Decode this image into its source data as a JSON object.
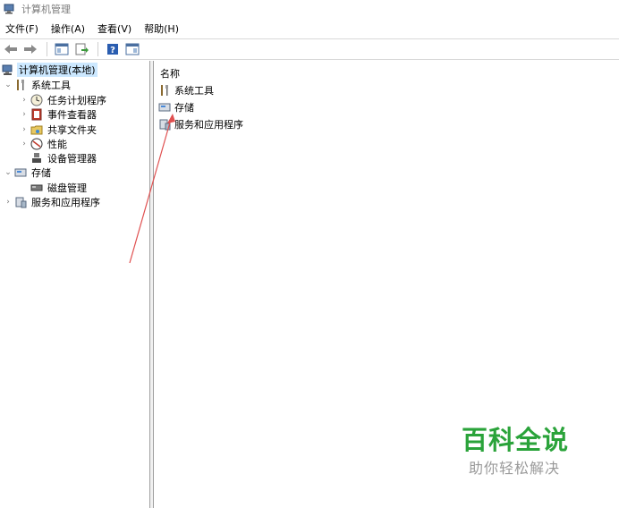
{
  "window": {
    "title": "计算机管理"
  },
  "menu": [
    {
      "label": "文件(F)"
    },
    {
      "label": "操作(A)"
    },
    {
      "label": "查看(V)"
    },
    {
      "label": "帮助(H)"
    }
  ],
  "toolbar": {
    "buttons": [
      "back-arrow-icon",
      "forward-arrow-icon",
      "show-hide-tree-icon",
      "export-list-icon",
      "help-icon",
      "properties-icon"
    ]
  },
  "tree": {
    "root": "计算机管理(本地)",
    "system_tools": "系统工具",
    "task_scheduler": "任务计划程序",
    "event_viewer": "事件查看器",
    "shared_folders": "共享文件夹",
    "performance": "性能",
    "device_manager": "设备管理器",
    "storage": "存储",
    "disk_management": "磁盘管理",
    "services_apps": "服务和应用程序"
  },
  "list": {
    "column_name": "名称",
    "items": [
      "系统工具",
      "存储",
      "服务和应用程序"
    ]
  },
  "watermark": {
    "title": "百科全说",
    "subtitle": "助你轻松解决"
  },
  "colors": {
    "selection": "#cce8ff",
    "watermark_green": "#2aa33a",
    "annotation_arrow": "#e05050"
  }
}
